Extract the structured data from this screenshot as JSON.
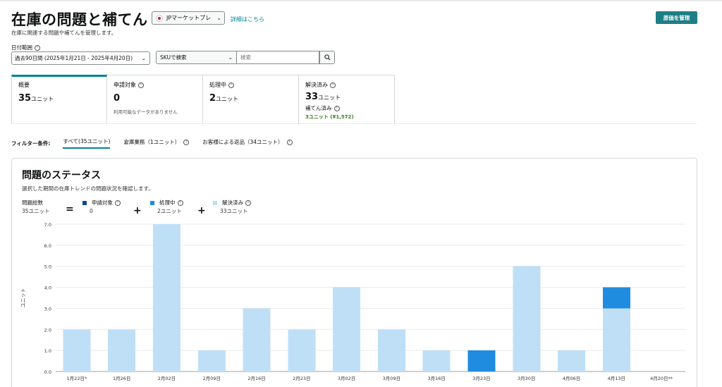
{
  "header": {
    "title": "在庫の問題と補てん",
    "marketplace": "JPマーケットプレ",
    "details_link": "詳細はこちら",
    "manage_button": "原価を管理",
    "subtitle": "在庫に関連する問題や補てんを管理します。"
  },
  "filters_bar": {
    "date_label": "日付範囲",
    "date_value": "過去90日間 (2025年1月21日 - 2025年4月20日)",
    "sku_select": "SKUで検索",
    "search_placeholder": "検索"
  },
  "tabs": [
    {
      "label": "概要",
      "value_num": "35",
      "value_unit": "ユニット"
    },
    {
      "label": "申請対象",
      "value_num": "0",
      "value_unit": "",
      "note": "利用可能なデータがありません"
    },
    {
      "label": "処理中",
      "value_num": "2",
      "value_unit": "ユニット"
    },
    {
      "label": "解決済み",
      "value_num": "33",
      "value_unit": "ユニット",
      "fill_label": "補てん済み",
      "fill_value": "3ユニット (¥1,572)"
    }
  ],
  "filter_conditions": {
    "label": "フィルター条件:",
    "options": [
      "すべて(35ユニット)",
      "倉庫業務（1ユニット）",
      "お客様による返品（34ユニット）"
    ]
  },
  "status_panel": {
    "title": "問題のステータス",
    "subtitle": "選択した期間の在庫トレンドの問題状況を確認します。",
    "total_label": "問題総数",
    "total_value": "35ユニット",
    "eq": "=",
    "plus": "+",
    "legend": [
      {
        "name": "申請対象",
        "value": "0",
        "color": "#0d4a8f"
      },
      {
        "name": "処理中",
        "value": "2ユニット",
        "color": "#1f8ce0"
      },
      {
        "name": "解決済み",
        "value": "33ユニット",
        "color": "#bfdff7"
      }
    ]
  },
  "chart_data": {
    "type": "bar",
    "stacked": true,
    "ylabel": "ユニット",
    "ylim": [
      0,
      7
    ],
    "yticks": [
      "0.0",
      "1.0",
      "2.0",
      "3.0",
      "4.0",
      "5.0",
      "6.0",
      "7.0"
    ],
    "categories": [
      "1月22日*",
      "1月26日",
      "2月02日",
      "2月09日",
      "2月16日",
      "2月23日",
      "3月02日",
      "3月09日",
      "3月16日",
      "3月23日",
      "3月30日",
      "4月06日",
      "4月13日",
      "4月20日**"
    ],
    "series": [
      {
        "name": "解決済み",
        "color": "#bfdff7",
        "values": [
          2,
          2,
          7,
          1,
          3,
          2,
          4,
          2,
          1,
          0,
          5,
          1,
          3,
          0
        ]
      },
      {
        "name": "処理中",
        "color": "#1f8ce0",
        "values": [
          0,
          0,
          0,
          0,
          0,
          0,
          0,
          0,
          0,
          1,
          0,
          0,
          1,
          0
        ]
      },
      {
        "name": "申請対象",
        "color": "#0d4a8f",
        "values": [
          0,
          0,
          0,
          0,
          0,
          0,
          0,
          0,
          0,
          0,
          0,
          0,
          0,
          0
        ]
      }
    ],
    "grid": true
  }
}
